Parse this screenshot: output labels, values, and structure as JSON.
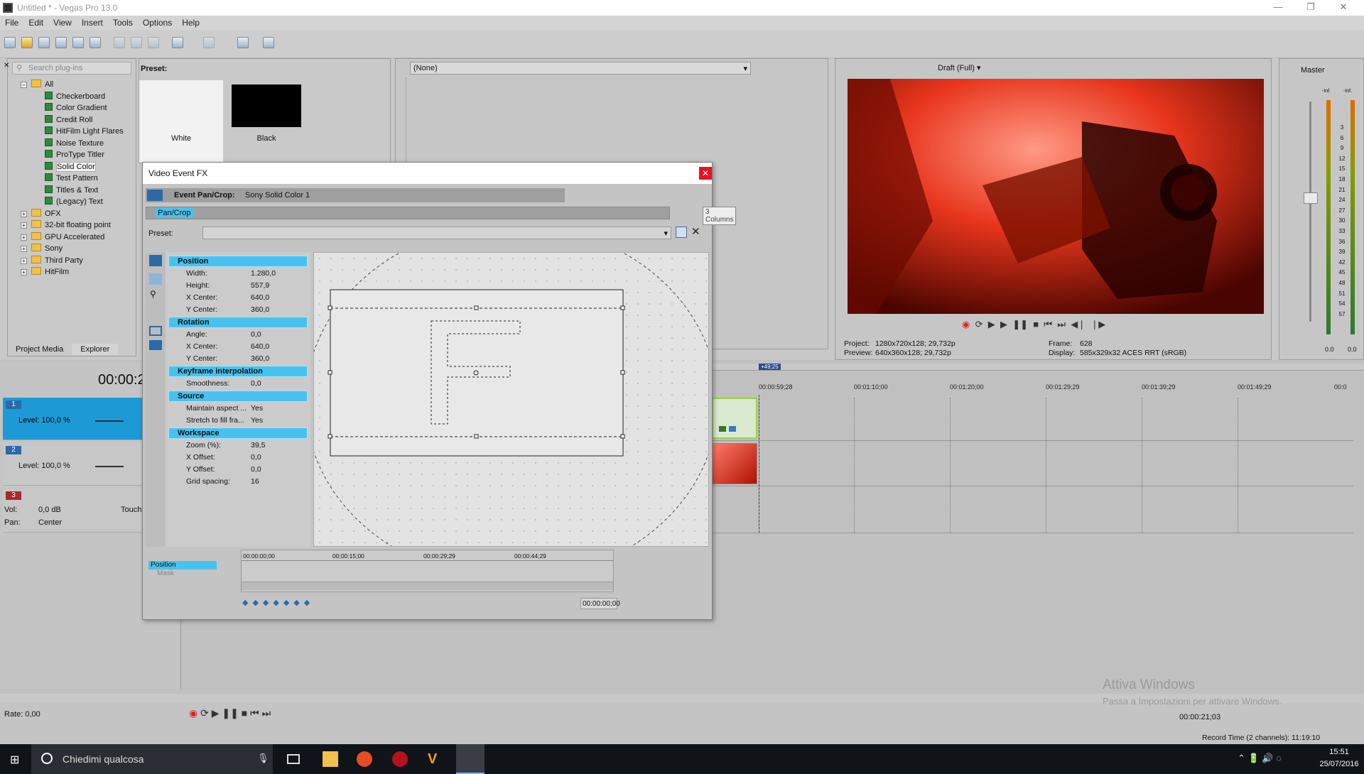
{
  "window": {
    "title": "Untitled * - Vegas Pro 13.0"
  },
  "menu": [
    "File",
    "Edit",
    "View",
    "Insert",
    "Tools",
    "Options",
    "Help"
  ],
  "plugins": {
    "search_placeholder": "Search plug-ins",
    "tree": [
      {
        "label": "All",
        "type": "root"
      },
      {
        "label": "Checkerboard",
        "type": "fx"
      },
      {
        "label": "Color Gradient",
        "type": "fx"
      },
      {
        "label": "Credit Roll",
        "type": "fx"
      },
      {
        "label": "HitFilm Light Flares",
        "type": "fx"
      },
      {
        "label": "Noise Texture",
        "type": "fx"
      },
      {
        "label": "ProType Titler",
        "type": "fx"
      },
      {
        "label": "Solid Color",
        "type": "fx",
        "selected": true
      },
      {
        "label": "Test Pattern",
        "type": "fx"
      },
      {
        "label": "Titles & Text",
        "type": "fx"
      },
      {
        "label": "(Legacy) Text",
        "type": "fx"
      },
      {
        "label": "OFX",
        "type": "folder"
      },
      {
        "label": "32-bit floating point",
        "type": "folder"
      },
      {
        "label": "GPU Accelerated",
        "type": "folder"
      },
      {
        "label": "Sony",
        "type": "folder"
      },
      {
        "label": "Third Party",
        "type": "folder"
      },
      {
        "label": "HitFilm",
        "type": "folder"
      }
    ],
    "tabs": [
      "Project Media",
      "Explorer"
    ]
  },
  "preset_panel": {
    "title": "Preset:",
    "items": [
      "White",
      "Black"
    ]
  },
  "event_chain": {
    "dropdown": "(None)"
  },
  "preview": {
    "quality": "Draft (Full)",
    "project_label": "Project:",
    "project": "1280x720x128; 29,732p",
    "preview_label": "Preview:",
    "preview": "640x360x128; 29,732p",
    "frame_label": "Frame:",
    "frame": "628",
    "display_label": "Display:",
    "display": "585x329x32 ACES RRT (sRGB)"
  },
  "master": {
    "title": "Master",
    "scale": [
      "3",
      "6",
      "9",
      "12",
      "15",
      "18",
      "21",
      "24",
      "27",
      "30",
      "33",
      "36",
      "39",
      "42",
      "45",
      "48",
      "51",
      "54",
      "57"
    ],
    "top_left": "-Inf.",
    "top_right": "-Inf.",
    "bottom_left": "0.0",
    "bottom_right": "0.0"
  },
  "dialog": {
    "title": "Video Event FX",
    "event_label": "Event Pan/Crop:",
    "event_name": "Sony Solid Color 1",
    "chain_item": "Pan/Crop",
    "tooltip": "3 Columns",
    "preset_label": "Preset:",
    "sections": [
      {
        "name": "Position",
        "rows": [
          [
            "Width:",
            "1.280,0"
          ],
          [
            "Height:",
            "557,9"
          ],
          [
            "X Center:",
            "640,0"
          ],
          [
            "Y Center:",
            "360,0"
          ]
        ]
      },
      {
        "name": "Rotation",
        "rows": [
          [
            "Angle:",
            "0,0"
          ],
          [
            "X Center:",
            "640,0"
          ],
          [
            "Y Center:",
            "360,0"
          ]
        ]
      },
      {
        "name": "Keyframe interpolation",
        "rows": [
          [
            "Smoothness:",
            "0,0"
          ]
        ]
      },
      {
        "name": "Source",
        "rows": [
          [
            "Maintain aspect ...",
            "Yes"
          ],
          [
            "Stretch to fill fra...",
            "Yes"
          ]
        ]
      },
      {
        "name": "Workspace",
        "rows": [
          [
            "Zoom (%):",
            "39,5"
          ],
          [
            "X Offset:",
            "0,0"
          ],
          [
            "Y Offset:",
            "0,0"
          ],
          [
            "Grid spacing:",
            "16"
          ]
        ]
      }
    ],
    "kf_tracks": [
      "Position",
      "Mask"
    ],
    "kf_times": [
      "00:00:00;00",
      "00:00:15;00",
      "00:00:29;29",
      "00:00:44;29"
    ],
    "kf_time_display": "00:00:00;00",
    "canvas_letter": "F"
  },
  "timeline": {
    "time_display": "00:00:2",
    "ruler": [
      "00:00:59;28",
      "00:01:10;00",
      "00:01:20;00",
      "00:01:29;29",
      "00:01:39;29",
      "00:01:49;29",
      "00:0"
    ],
    "marker": "+49;25",
    "tracks": [
      {
        "num": "1",
        "level_label": "Level: 100,0 %"
      },
      {
        "num": "2",
        "level_label": "Level: 100,0 %"
      },
      {
        "num": "3",
        "vol_label": "Vol:",
        "vol": "0,0 dB",
        "pan_label": "Pan:",
        "pan": "Center",
        "touch": "Touch"
      }
    ],
    "rate": "Rate: 0,00",
    "position": "00:00:21;03",
    "record_time": "Record Time (2 channels): 11:19:10"
  },
  "watermark": {
    "line1": "Attiva Windows",
    "line2": "Passa a Impostazioni per attivare Windows."
  },
  "taskbar": {
    "search": "Chiedimi qualcosa",
    "time": "15:51",
    "date": "25/07/2016"
  }
}
